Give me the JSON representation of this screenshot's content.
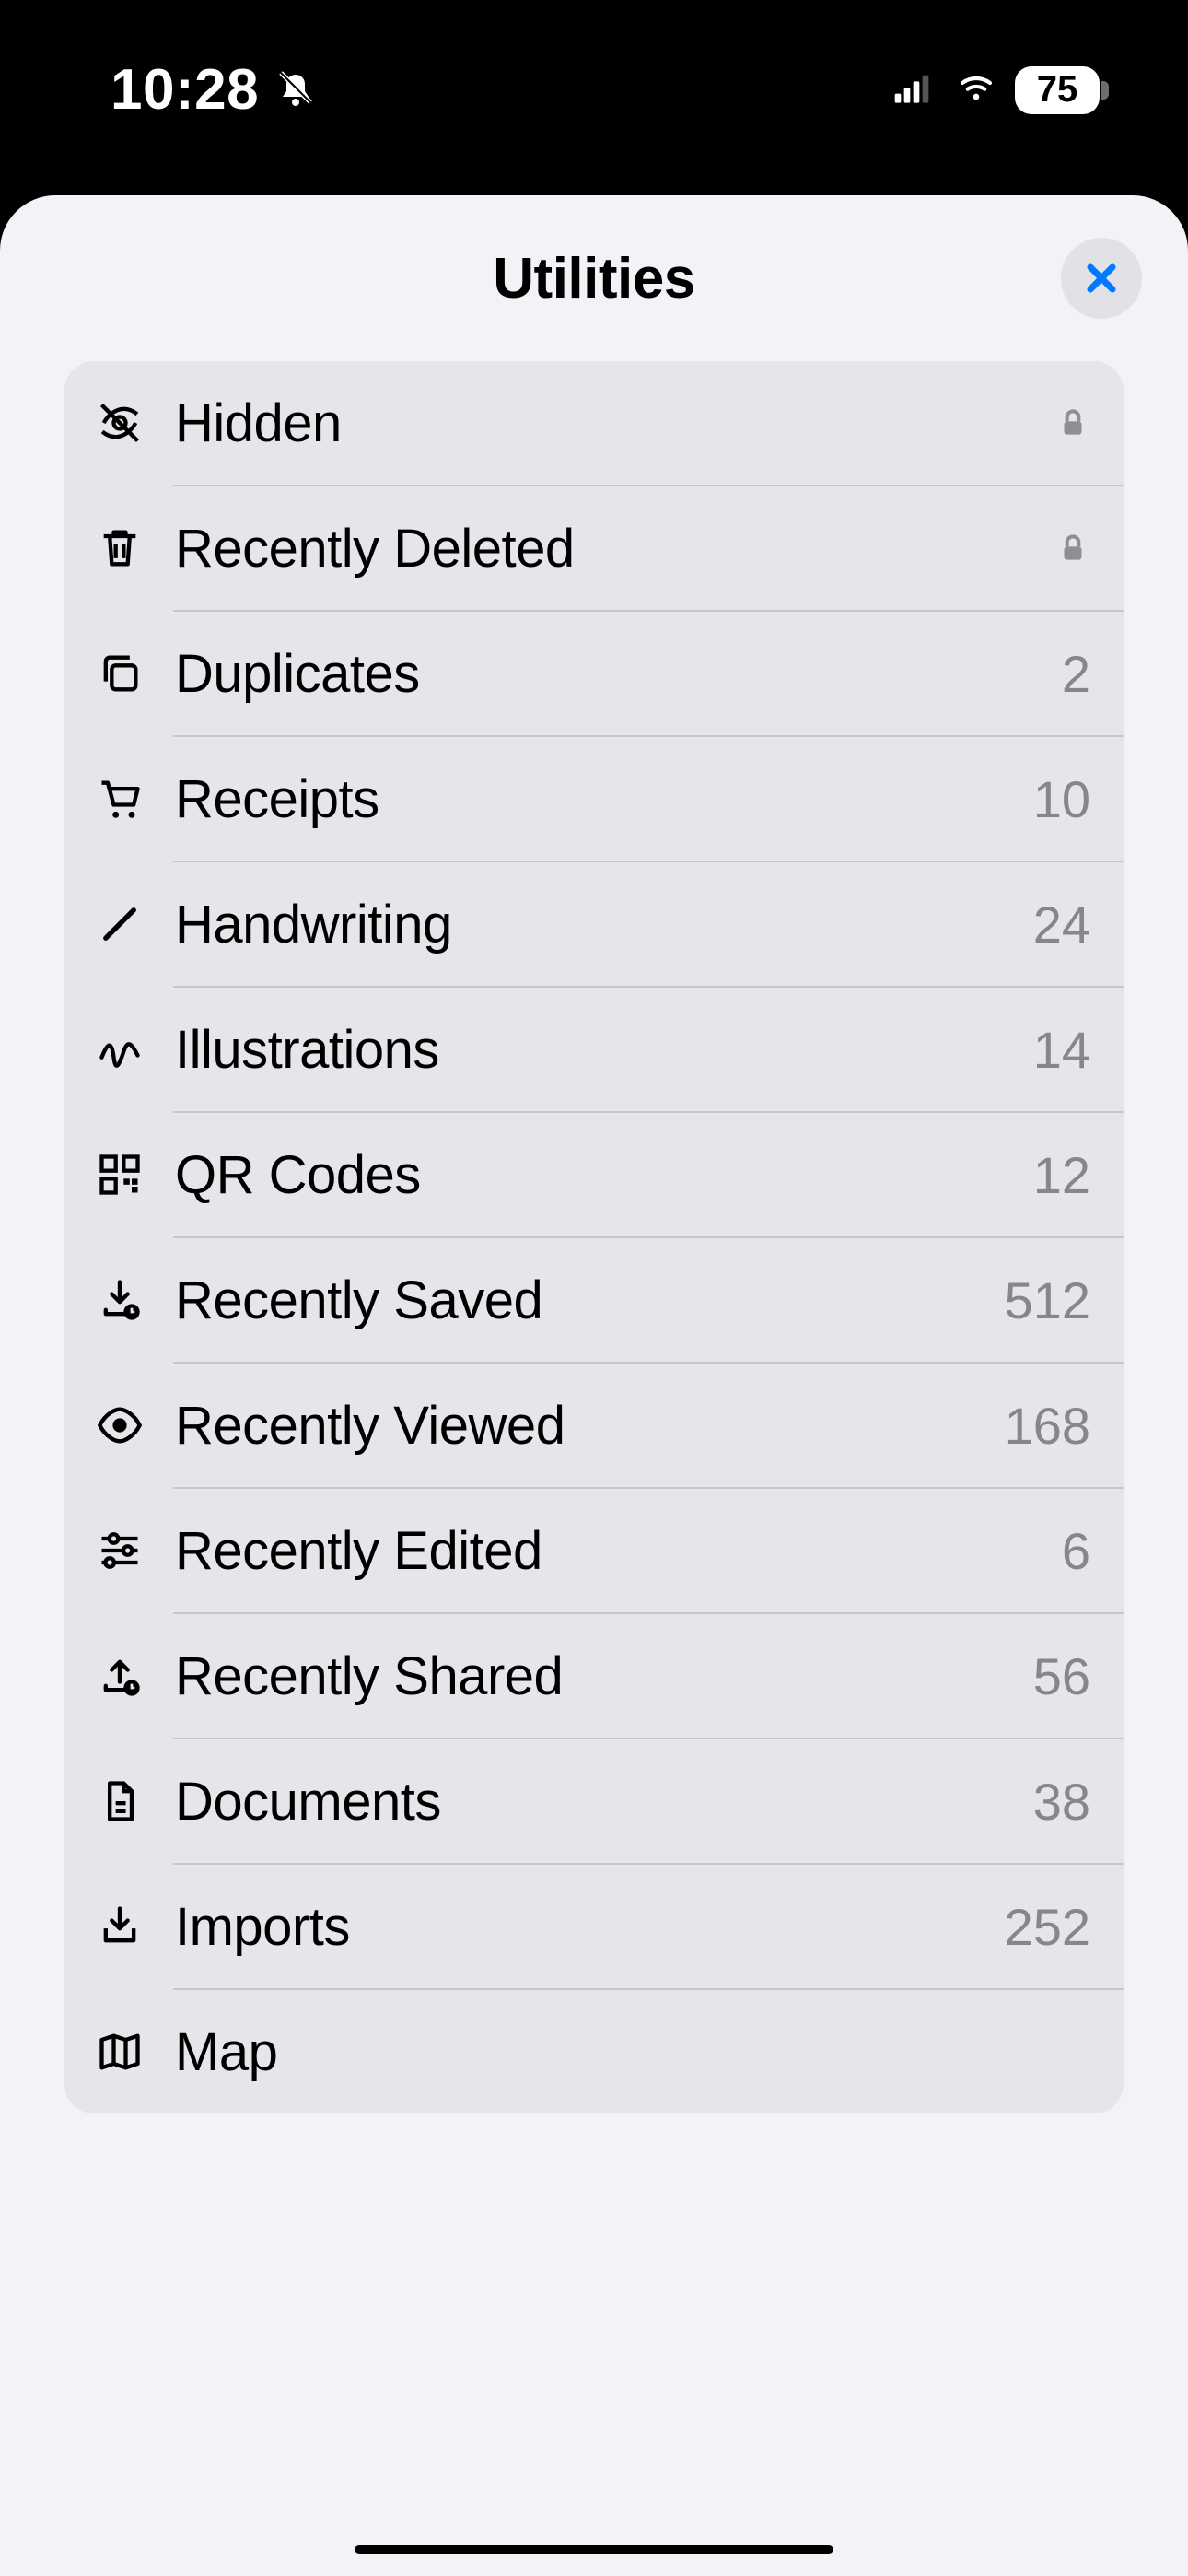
{
  "statusbar": {
    "time": "10:28",
    "battery_percent": "75"
  },
  "sheet": {
    "title": "Utilities"
  },
  "rows": [
    {
      "icon": "eye-slash-icon",
      "label": "Hidden",
      "accessory": "lock"
    },
    {
      "icon": "trash-icon",
      "label": "Recently Deleted",
      "accessory": "lock"
    },
    {
      "icon": "copy-icon",
      "label": "Duplicates",
      "accessory": "count",
      "count": "2"
    },
    {
      "icon": "cart-icon",
      "label": "Receipts",
      "accessory": "count",
      "count": "10"
    },
    {
      "icon": "pencil-icon",
      "label": "Handwriting",
      "accessory": "count",
      "count": "24"
    },
    {
      "icon": "scribble-icon",
      "label": "Illustrations",
      "accessory": "count",
      "count": "14"
    },
    {
      "icon": "qrcode-icon",
      "label": "QR Codes",
      "accessory": "count",
      "count": "12"
    },
    {
      "icon": "download-clock-icon",
      "label": "Recently Saved",
      "accessory": "count",
      "count": "512"
    },
    {
      "icon": "eye-icon",
      "label": "Recently Viewed",
      "accessory": "count",
      "count": "168"
    },
    {
      "icon": "sliders-icon",
      "label": "Recently Edited",
      "accessory": "count",
      "count": "6"
    },
    {
      "icon": "upload-clock-icon",
      "label": "Recently Shared",
      "accessory": "count",
      "count": "56"
    },
    {
      "icon": "document-icon",
      "label": "Documents",
      "accessory": "count",
      "count": "38"
    },
    {
      "icon": "import-icon",
      "label": "Imports",
      "accessory": "count",
      "count": "252"
    },
    {
      "icon": "map-icon",
      "label": "Map",
      "accessory": "none"
    }
  ]
}
